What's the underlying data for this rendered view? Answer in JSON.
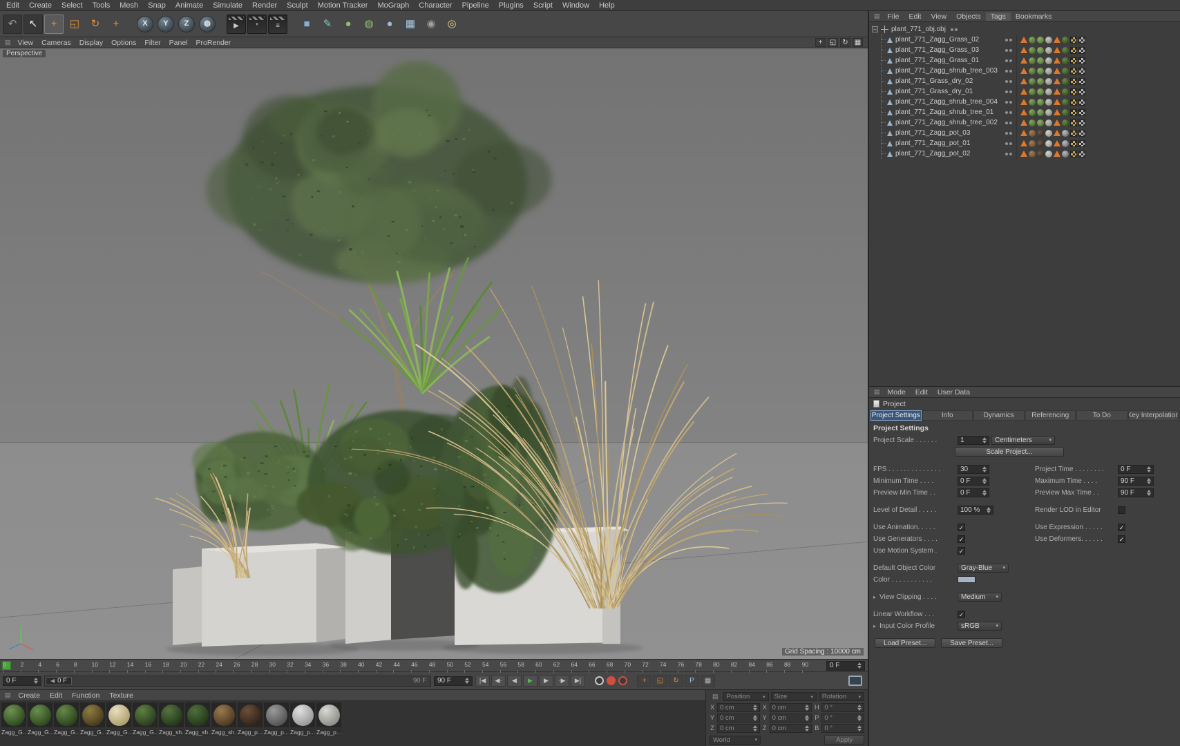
{
  "icons": {
    "grip": "▤",
    "dropdown_arrow": "▾",
    "expander": "−",
    "check": "✓",
    "section_arrow": "▸",
    "playhead_arrow": "◀"
  },
  "menu_bar": {
    "items": [
      "Edit",
      "Create",
      "Select",
      "Tools",
      "Mesh",
      "Snap",
      "Animate",
      "Simulate",
      "Render",
      "Sculpt",
      "Motion Tracker",
      "MoGraph",
      "Character",
      "Pipeline",
      "Plugins",
      "Script",
      "Window",
      "Help"
    ]
  },
  "toolbar": {
    "icons": [
      {
        "name": "undo-icon",
        "glyph": "↶",
        "c": "#9a9a9a",
        "shape": "dark"
      },
      {
        "name": "live-selection-icon",
        "glyph": "↖",
        "c": "#f0f0f0",
        "shape": "dark",
        "pressed": true
      },
      {
        "name": "move-tool-icon",
        "glyph": "+",
        "c": "#e8913c",
        "pressed": true
      },
      {
        "name": "scale-tool-icon",
        "glyph": "◱",
        "c": "#e8913c"
      },
      {
        "name": "rotate-tool-icon",
        "glyph": "↻",
        "c": "#e8913c"
      },
      {
        "name": "last-used-tool-icon",
        "glyph": "+",
        "c": "#e8913c"
      },
      {
        "sep": true
      },
      {
        "name": "x-axis-lock-icon",
        "glyph": "X",
        "shape": "circle"
      },
      {
        "name": "y-axis-lock-icon",
        "glyph": "Y",
        "shape": "circle"
      },
      {
        "name": "z-axis-lock-icon",
        "glyph": "Z",
        "shape": "circle"
      },
      {
        "name": "coordinate-system-icon",
        "glyph": "◍",
        "shape": "circle"
      },
      {
        "sep": true
      },
      {
        "name": "render-view-icon",
        "glyph": "▶",
        "c": "#c8c8c8",
        "shape": "clapper"
      },
      {
        "name": "render-settings-icon",
        "glyph": "*",
        "c": "#c8c8c8",
        "shape": "clapper"
      },
      {
        "name": "render-queue-icon",
        "glyph": "≡",
        "c": "#c8c8c8",
        "shape": "clapper"
      },
      {
        "sep": true
      },
      {
        "name": "primitive-cube-icon",
        "glyph": "■",
        "c": "#86aed6"
      },
      {
        "name": "spline-pen-icon",
        "glyph": "✎",
        "c": "#7cc8c0"
      },
      {
        "name": "subdivision-surface-icon",
        "glyph": "●",
        "c": "#8cc06a"
      },
      {
        "name": "generators-icon",
        "glyph": "◍",
        "c": "#8cc06a"
      },
      {
        "name": "deformers-icon",
        "glyph": "●",
        "c": "#9fb8d8"
      },
      {
        "name": "clone-array-icon",
        "glyph": "▦",
        "c": "#a8cce8"
      },
      {
        "name": "camera-icon",
        "glyph": "◉",
        "c": "#a0a0a0"
      },
      {
        "name": "light-icon",
        "glyph": "◎",
        "c": "#e8d890"
      }
    ]
  },
  "viewport": {
    "menu": [
      "View",
      "Cameras",
      "Display",
      "Options",
      "Filter",
      "Panel",
      "ProRender"
    ],
    "camera_label": "Perspective",
    "grid_spacing": "Grid Spacing : 10000 cm",
    "view_icons": [
      {
        "name": "pan-view-icon",
        "glyph": "+"
      },
      {
        "name": "zoom-view-icon",
        "glyph": "◱"
      },
      {
        "name": "rotate-view-icon",
        "glyph": "↻"
      },
      {
        "name": "toggle-views-icon",
        "glyph": "▦"
      }
    ]
  },
  "object_manager": {
    "menu": [
      {
        "label": "File"
      },
      {
        "label": "Edit"
      },
      {
        "label": "View"
      },
      {
        "label": "Objects"
      },
      {
        "label": "Tags",
        "active": true
      },
      {
        "label": "Bookmarks"
      }
    ],
    "root": {
      "name": "plant_771_obj.obj"
    },
    "tag_sets": {
      "plant": [
        {
          "t": "tri",
          "c": "#e0782a",
          "n": "phong-tag-icon"
        },
        {
          "t": "sph",
          "c": "#4e6e33",
          "h": "#86a85c",
          "n": "material-tag-icon"
        },
        {
          "t": "sph",
          "c": "#5a7a40",
          "h": "#8fae66",
          "n": "material-tag-icon"
        },
        {
          "t": "sph",
          "c": "#8f8f85",
          "h": "#c9c9bd",
          "n": "material-tag-icon"
        },
        {
          "t": "tri",
          "c": "#e0782a",
          "n": "phong-tag-icon"
        },
        {
          "t": "sph",
          "c": "#3c5426",
          "h": "#6c8a4a",
          "n": "material-tag-icon"
        },
        {
          "t": "chk",
          "c": "#caa84e",
          "n": "uv-tag-icon"
        },
        {
          "t": "chk",
          "c": "#b8b8b8",
          "n": "uv-tag-icon"
        }
      ],
      "pot": [
        {
          "t": "tri",
          "c": "#e0782a",
          "n": "phong-tag-icon"
        },
        {
          "t": "sph",
          "c": "#6e5238",
          "h": "#a3805a",
          "n": "material-tag-icon"
        },
        {
          "t": "sph",
          "c": "#3c2f22",
          "h": "#6e5a42",
          "n": "material-tag-icon"
        },
        {
          "t": "sph",
          "c": "#9a9a96",
          "h": "#d5d5cf",
          "n": "material-tag-icon"
        },
        {
          "t": "tri",
          "c": "#e0782a",
          "n": "phong-tag-icon"
        },
        {
          "t": "sph",
          "c": "#777777",
          "h": "#bbbbbb",
          "n": "material-tag-icon"
        },
        {
          "t": "chk",
          "c": "#caa84e",
          "n": "uv-tag-icon"
        },
        {
          "t": "chk",
          "c": "#b8b8b8",
          "n": "uv-tag-icon"
        }
      ]
    },
    "objects": [
      {
        "name": "plant_771_Zagg_Grass_02",
        "tagset": "plant"
      },
      {
        "name": "plant_771_Zagg_Grass_03",
        "tagset": "plant"
      },
      {
        "name": "plant_771_Zagg_Grass_01",
        "tagset": "plant"
      },
      {
        "name": "plant_771_Zagg_shrub_tree_003",
        "tagset": "plant"
      },
      {
        "name": "plant_771_Grass_dry_02",
        "tagset": "plant"
      },
      {
        "name": "plant_771_Grass_dry_01",
        "tagset": "plant"
      },
      {
        "name": "plant_771_Zagg_shrub_tree_004",
        "tagset": "plant"
      },
      {
        "name": "plant_771_Zagg_shrub_tree_01",
        "tagset": "plant"
      },
      {
        "name": "plant_771_Zagg_shrub_tree_002",
        "tagset": "plant"
      },
      {
        "name": "plant_771_Zagg_pot_03",
        "tagset": "pot"
      },
      {
        "name": "plant_771_Zagg_pot_01",
        "tagset": "pot"
      },
      {
        "name": "plant_771_Zagg_pot_02",
        "tagset": "pot"
      }
    ]
  },
  "attribute_manager": {
    "menu": [
      "Mode",
      "Edit",
      "User Data"
    ],
    "object_label": "Project",
    "tabs": [
      {
        "label": "Project Settings",
        "active": true
      },
      {
        "label": "Info"
      },
      {
        "label": "Dynamics"
      },
      {
        "label": "Referencing"
      },
      {
        "label": "To Do"
      },
      {
        "label": "Key Interpolation"
      }
    ],
    "section": "Project Settings",
    "fields": {
      "project_scale": {
        "label": "Project Scale . . . . . .",
        "value": "1",
        "unit": "Centimeters"
      },
      "scale_project_button": "Scale Project...",
      "fps": {
        "label": "FPS . . . . . . . . . . . . . .",
        "value": "30"
      },
      "project_time": {
        "label": "Project Time . . . . . . . .",
        "value": "0 F"
      },
      "minimum_time": {
        "label": "Minimum Time . . . .",
        "value": "0 F"
      },
      "maximum_time": {
        "label": "Maximum Time . . . .",
        "value": "90 F"
      },
      "preview_min_time": {
        "label": "Preview Min Time . .",
        "value": "0 F"
      },
      "preview_max_time": {
        "label": "Preview Max Time . .",
        "value": "90 F"
      },
      "level_of_detail": {
        "label": "Level of Detail . . . . .",
        "value": "100 %"
      },
      "render_lod": {
        "label": "Render LOD in Editor",
        "checked": false
      },
      "use_animation": {
        "label": "Use Animation. . . . .",
        "checked": true
      },
      "use_expression": {
        "label": "Use Expression . . . . .",
        "checked": true
      },
      "use_generators": {
        "label": "Use Generators . . . .",
        "checked": true
      },
      "use_deformers": {
        "label": "Use Deformers. . . . . .",
        "checked": true
      },
      "use_motion_system": {
        "label": "Use Motion System .",
        "checked": true
      },
      "default_object_color": {
        "label": "Default Object Color",
        "value": "Gray-Blue"
      },
      "color": {
        "label": "Color . . . . . . . . . . .",
        "swatch": "#a8b4c0"
      },
      "view_clipping": {
        "label": "View Clipping . . . .",
        "value": "Medium"
      },
      "linear_workflow": {
        "label": "Linear Workflow . . .",
        "checked": true
      },
      "input_color_profile": {
        "label": "Input Color Profile",
        "value": "sRGB"
      },
      "load_preset_button": "Load Preset...",
      "save_preset_button": "Save Preset..."
    }
  },
  "timeline": {
    "ticks": [
      "0",
      "2",
      "4",
      "6",
      "8",
      "10",
      "12",
      "14",
      "16",
      "18",
      "20",
      "22",
      "24",
      "26",
      "28",
      "30",
      "32",
      "34",
      "36",
      "38",
      "40",
      "42",
      "44",
      "46",
      "48",
      "50",
      "52",
      "54",
      "56",
      "58",
      "60",
      "62",
      "64",
      "66",
      "68",
      "70",
      "72",
      "74",
      "76",
      "78",
      "80",
      "82",
      "84",
      "86",
      "88",
      "90"
    ],
    "current_frame": "0 F",
    "playhead_label": "0 F",
    "range_start": "0 F",
    "range_end_label": "90 F",
    "max_time": "90 F",
    "transport": [
      {
        "name": "goto-start-button",
        "glyph": "|◀"
      },
      {
        "name": "previous-key-button",
        "glyph": "◀·"
      },
      {
        "name": "previous-frame-button",
        "glyph": "◀"
      },
      {
        "name": "play-button",
        "glyph": "▶",
        "c": "#57b751"
      },
      {
        "name": "next-frame-button",
        "glyph": "▶"
      },
      {
        "name": "next-key-button",
        "glyph": "·▶"
      },
      {
        "name": "goto-end-button",
        "glyph": "▶|"
      }
    ],
    "record_icons": [
      {
        "name": "record-active-objects-button",
        "c": "#c8c8c8",
        "fill": "#3a3a3a"
      },
      {
        "name": "autokeying-button",
        "c": "#d05040",
        "fill": "#d05040"
      },
      {
        "name": "keyframe-selection-button",
        "c": "#d05040",
        "fill": "#3a3a3a"
      }
    ],
    "record_toggles": [
      {
        "name": "record-position-toggle",
        "glyph": "+",
        "c": "#e8913c"
      },
      {
        "name": "record-scale-toggle",
        "glyph": "◱",
        "c": "#e8913c"
      },
      {
        "name": "record-rotation-toggle",
        "glyph": "↻",
        "c": "#e8913c"
      },
      {
        "name": "record-parameter-toggle",
        "glyph": "P",
        "c": "#9ec1e8"
      },
      {
        "name": "record-pla-toggle",
        "glyph": "▦",
        "c": "#b5b5b5"
      }
    ]
  },
  "material_manager": {
    "menu": [
      "Create",
      "Edit",
      "Function",
      "Texture"
    ],
    "materials": [
      {
        "label": "Zagg_G...",
        "c": "#2f4a21",
        "h": "#6f9450"
      },
      {
        "label": "Zagg_G...",
        "c": "#2f4a21",
        "h": "#6a8f4c"
      },
      {
        "label": "Zagg_G...",
        "c": "#2c451f",
        "h": "#648a48"
      },
      {
        "label": "Zagg_G...",
        "c": "#4a3d1e",
        "h": "#8f7c42"
      },
      {
        "label": "Zagg_G...",
        "c": "#b0a070",
        "h": "#e8dfc0"
      },
      {
        "label": "Zagg_G...",
        "c": "#2a401e",
        "h": "#5f7f42"
      },
      {
        "label": "Zagg_sh...",
        "c": "#253a1c",
        "h": "#557440"
      },
      {
        "label": "Zagg_sh...",
        "c": "#253a1c",
        "h": "#4f6e3c"
      },
      {
        "label": "Zagg_sh...",
        "c": "#4f3a22",
        "h": "#9a7a50"
      },
      {
        "label": "Zagg_p...",
        "c": "#33241a",
        "h": "#6a4f38"
      },
      {
        "label": "Zagg_p...",
        "c": "#555555",
        "h": "#9a9a9a"
      },
      {
        "label": "Zagg_p...",
        "c": "#9a9a9a",
        "h": "#e0e0e0"
      },
      {
        "label": "Zagg_p...",
        "c": "#8f8f88",
        "h": "#d8d8d4"
      }
    ]
  },
  "coordinate_manager": {
    "columns": [
      {
        "header": "Position",
        "rows": [
          {
            "a": "X",
            "v": "0 cm"
          },
          {
            "a": "Y",
            "v": "0 cm"
          },
          {
            "a": "Z",
            "v": "0 cm"
          }
        ]
      },
      {
        "header": "Size",
        "rows": [
          {
            "a": "X",
            "v": "0 cm"
          },
          {
            "a": "Y",
            "v": "0 cm"
          },
          {
            "a": "Z",
            "v": "0 cm"
          }
        ]
      },
      {
        "header": "Rotation",
        "rows": [
          {
            "a": "H",
            "v": "0 °"
          },
          {
            "a": "P",
            "v": "0 °"
          },
          {
            "a": "B",
            "v": "0 °"
          }
        ]
      }
    ],
    "space": "World",
    "apply_label": "Apply"
  }
}
